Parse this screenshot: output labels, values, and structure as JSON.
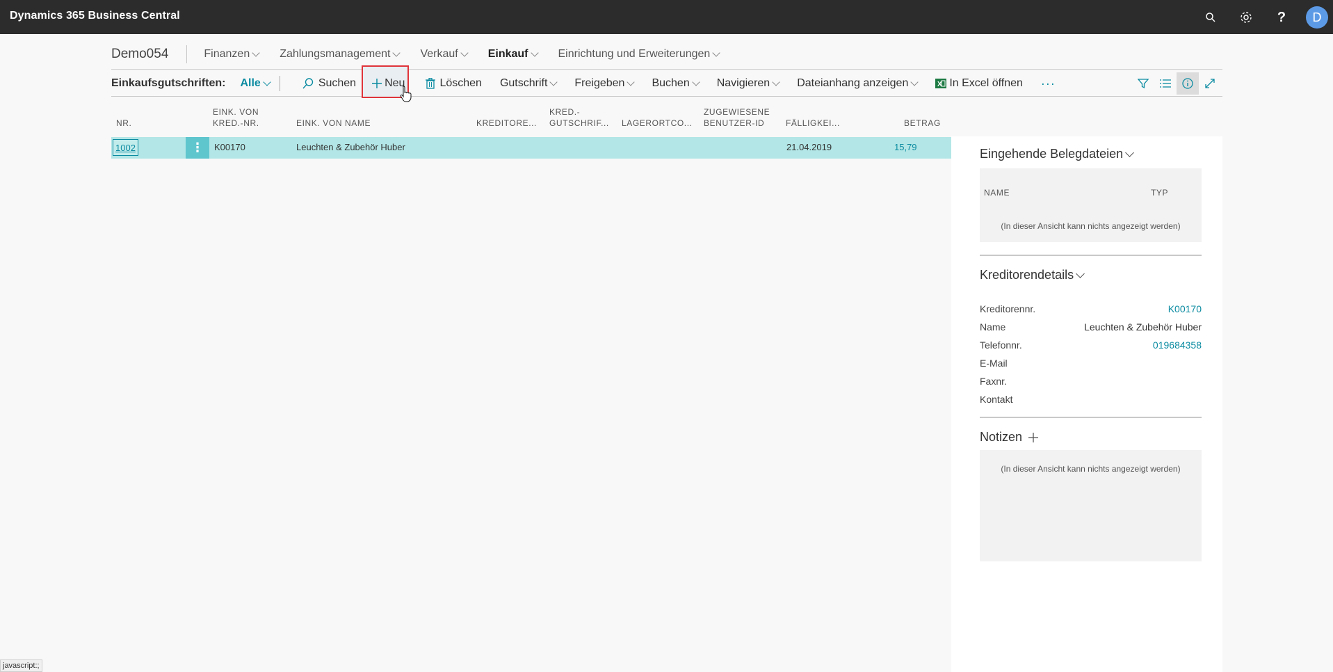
{
  "app": {
    "title": "Dynamics 365 Business Central",
    "avatar_initial": "D"
  },
  "nav": {
    "company": "Demo054",
    "items": [
      {
        "label": "Finanzen"
      },
      {
        "label": "Zahlungsmanagement"
      },
      {
        "label": "Verkauf"
      },
      {
        "label": "Einkauf",
        "active": true
      },
      {
        "label": "Einrichtung und Erweiterungen"
      }
    ]
  },
  "actionbar": {
    "caption": "Einkaufsgutschriften:",
    "filter": "Alle",
    "search": "Suchen",
    "new": "Neu",
    "delete": "Löschen",
    "credit_memo": "Gutschrift",
    "release": "Freigeben",
    "post": "Buchen",
    "navigate": "Navigieren",
    "attachment": "Dateianhang anzeigen",
    "excel": "In Excel öffnen",
    "more": "···"
  },
  "list": {
    "columns": {
      "nr": "NR.",
      "vendor_no": [
        "EINK. VON",
        "KRED.-NR."
      ],
      "vendor_name": "EINK. VON NAME",
      "kreditor": "KREDITORE...",
      "kred_gutschrift": [
        "KRED.-",
        "GUTSCHRIF..."
      ],
      "lagerort": "LAGERORTCO...",
      "benutzer": [
        "ZUGEWIESENE",
        "BENUTZER-ID"
      ],
      "faellig": "FÄLLIGKEI...",
      "betrag": "BETRAG"
    },
    "rows": [
      {
        "nr": "1002",
        "vendor_no": "K00170",
        "vendor_name": "Leuchten & Zubehör Huber",
        "due_date": "21.04.2019",
        "amount": "15,79"
      }
    ]
  },
  "factbox": {
    "incoming_docs": {
      "title": "Eingehende Belegdateien",
      "col_name": "NAME",
      "col_type": "TYP",
      "empty": "(In dieser Ansicht kann nichts angezeigt werden)"
    },
    "vendor_details": {
      "title": "Kreditorendetails",
      "fields": [
        {
          "label": "Kreditorennr.",
          "value": "K00170",
          "link": true
        },
        {
          "label": "Name",
          "value": "Leuchten & Zubehör Huber",
          "link": false
        },
        {
          "label": "Telefonnr.",
          "value": "019684358",
          "link": true
        },
        {
          "label": "E-Mail",
          "value": "",
          "link": false
        },
        {
          "label": "Faxnr.",
          "value": "",
          "link": false
        },
        {
          "label": "Kontakt",
          "value": "",
          "link": false
        }
      ]
    },
    "notes": {
      "title": "Notizen",
      "empty": "(In dieser Ansicht kann nichts angezeigt werden)"
    }
  },
  "status_url": "javascript:;"
}
